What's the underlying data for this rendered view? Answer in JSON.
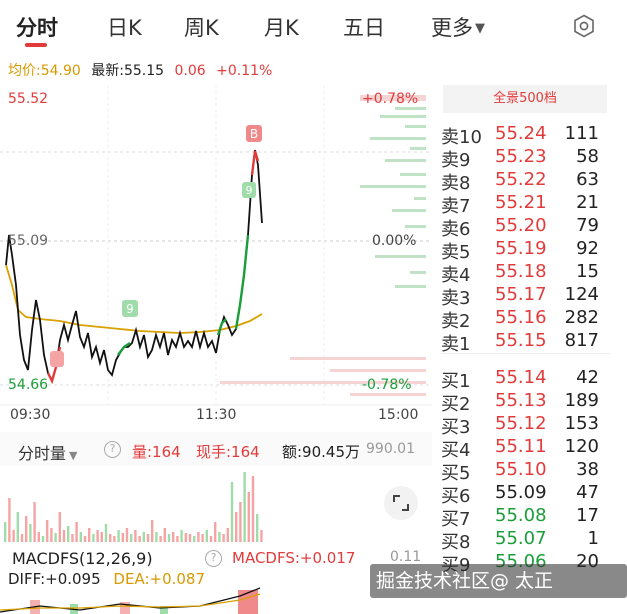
{
  "tabs": [
    "分时",
    "日K",
    "周K",
    "月K",
    "五日",
    "更多"
  ],
  "info": {
    "avg_label": "均价:54.90",
    "latest_label": "最新:55.15",
    "change": "0.06",
    "change_pct": "+0.11%"
  },
  "chart": {
    "price_high": "55.52",
    "price_mid": "55.09",
    "price_low": "54.66",
    "pct_high": "+0.78%",
    "pct_mid": "0.00%",
    "pct_low": "-0.78%",
    "marker_b": "B",
    "marker_9": "9",
    "times": [
      "09:30",
      "11:30",
      "15:00"
    ]
  },
  "book": {
    "header": "全景500档",
    "asks": [
      {
        "label": "卖10",
        "price": "55.24",
        "vol": "111"
      },
      {
        "label": "卖9",
        "price": "55.23",
        "vol": "58"
      },
      {
        "label": "卖8",
        "price": "55.22",
        "vol": "63"
      },
      {
        "label": "卖7",
        "price": "55.21",
        "vol": "21"
      },
      {
        "label": "卖6",
        "price": "55.20",
        "vol": "79"
      },
      {
        "label": "卖5",
        "price": "55.19",
        "vol": "92"
      },
      {
        "label": "卖4",
        "price": "55.18",
        "vol": "15"
      },
      {
        "label": "卖3",
        "price": "55.17",
        "vol": "124"
      },
      {
        "label": "卖2",
        "price": "55.16",
        "vol": "282"
      },
      {
        "label": "卖1",
        "price": "55.15",
        "vol": "817"
      }
    ],
    "bids": [
      {
        "label": "买1",
        "price": "55.14",
        "vol": "42"
      },
      {
        "label": "买2",
        "price": "55.13",
        "vol": "189"
      },
      {
        "label": "买3",
        "price": "55.12",
        "vol": "153"
      },
      {
        "label": "买4",
        "price": "55.11",
        "vol": "120"
      },
      {
        "label": "买5",
        "price": "55.10",
        "vol": "38"
      },
      {
        "label": "买6",
        "price": "55.09",
        "vol": "47"
      },
      {
        "label": "买7",
        "price": "55.08",
        "vol": "17"
      },
      {
        "label": "买8",
        "price": "55.07",
        "vol": "1"
      },
      {
        "label": "买9",
        "price": "55.06",
        "vol": "20"
      }
    ]
  },
  "volume": {
    "title": "分时量",
    "qty": "量:164",
    "now_hand": "现手:164",
    "amount": "额:90.45万",
    "max_value": "990.01"
  },
  "macd": {
    "title": "MACDFS(12,26,9)",
    "value": "MACDFS:+0.017",
    "scale": "0.11",
    "diff": "DIFF:+0.095",
    "dea": "DEA:+0.087"
  },
  "watermark": "掘金技术社区@ 太正",
  "colors": {
    "up": "#e23b3b",
    "down": "#1a9e3a",
    "avg": "#d99a00",
    "accent": "#e03a3a"
  }
}
